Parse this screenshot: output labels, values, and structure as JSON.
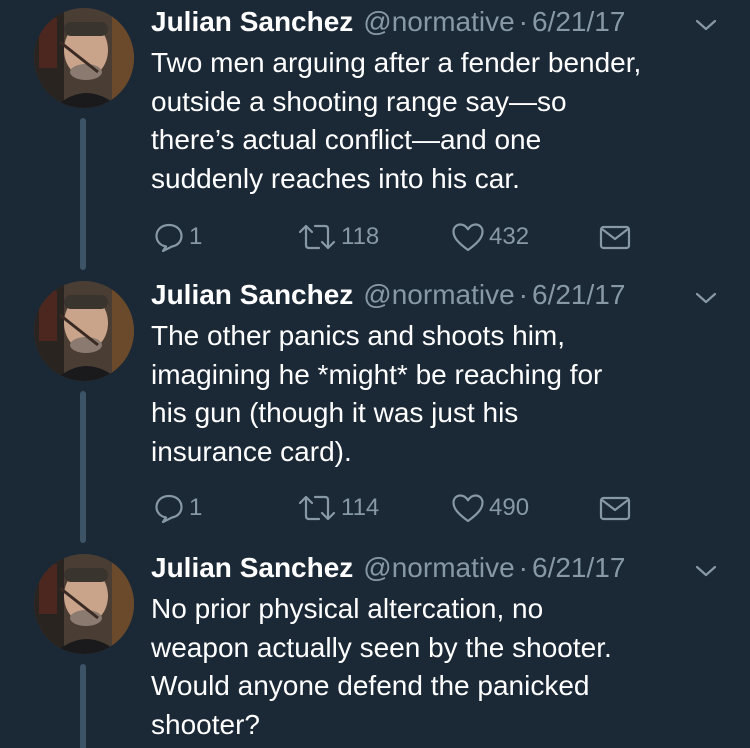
{
  "tweets": [
    {
      "name": "Julian Sanchez",
      "handle": "@normative",
      "separator": "·",
      "date": "6/21/17",
      "lines": [
        "Two men arguing after a fender bender,",
        "outside a shooting range say—so",
        "there’s actual conflict—and one",
        "suddenly reaches into his car."
      ],
      "replies": "1",
      "retweets": "118",
      "likes": "432"
    },
    {
      "name": "Julian Sanchez",
      "handle": "@normative",
      "separator": "·",
      "date": "6/21/17",
      "lines": [
        "The other panics and shoots him,",
        "imagining he *might* be reaching for",
        "his gun (though it was just his",
        "insurance card)."
      ],
      "replies": "1",
      "retweets": "114",
      "likes": "490"
    },
    {
      "name": "Julian Sanchez",
      "handle": "@normative",
      "separator": "·",
      "date": "6/21/17",
      "lines": [
        "No prior physical altercation, no",
        "weapon actually seen by the shooter.",
        "Would anyone defend the panicked",
        "shooter?"
      ]
    }
  ],
  "icons": {
    "reply": "reply-icon",
    "retweet": "retweet-icon",
    "like": "heart-icon",
    "dm": "envelope-icon",
    "caret": "chevron-down-icon"
  },
  "colors": {
    "background": "#1b2836",
    "secondary_text": "#8899a6",
    "thread_line": "#3d5466"
  }
}
